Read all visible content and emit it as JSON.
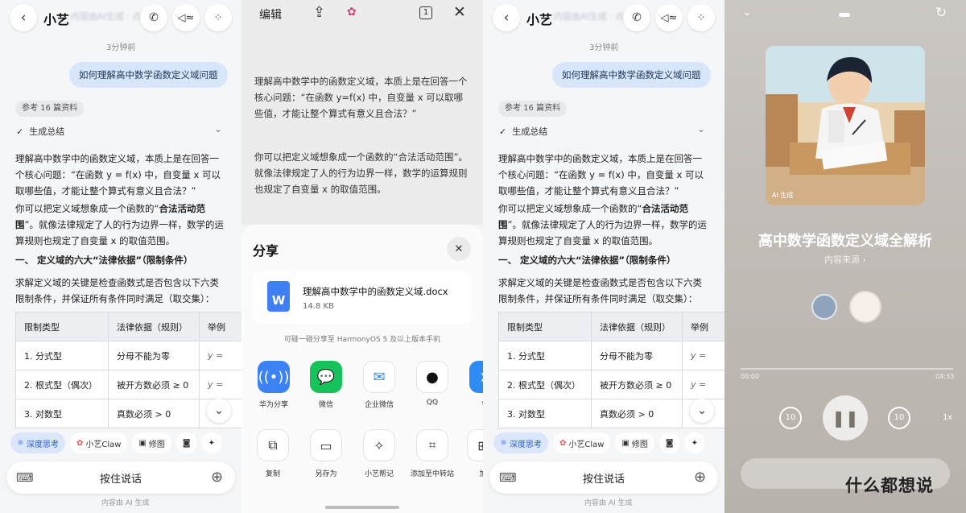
{
  "chat": {
    "title": "小艺",
    "subtitle_blur": "内容由AI生成 · 点击查看",
    "timestamp": "3分钟前",
    "user_msg": "如何理解高中数学函数定义域问题",
    "ref_label": "参考 16 篇资料",
    "summary_label": "生成总结",
    "para1": "理解高中数学中的函数定义域，本质上是在回答一个核心问题：“在函数 y = f(x) 中，自变量 x 可以取哪些值，才能让整个算式有意义且合法？”",
    "para2_a": "你可以把定义域想象成一个函数的“",
    "para2_bold": "合法活动范围",
    "para2_b": "”。就像法律规定了人的行为边界一样，数学的运算规则也规定了自变量 x 的取值范围。",
    "heading": "一、 定义域的六大“法律依据”（限制条件）",
    "para3": "求解定义域的关键是检查函数式是否包含以下六类限制条件，并保证所有条件同时满足（取交集）：",
    "table": {
      "headers": [
        "限制类型",
        "法律依据（规则）",
        "举例"
      ],
      "rows": [
        [
          "1. 分式型",
          "分母不能为零",
          "y ="
        ],
        [
          "2. 根式型（偶次）",
          "被开方数必须 ≥ 0",
          "y ="
        ],
        [
          "3. 对数型",
          "真数必须 > 0",
          ""
        ]
      ]
    },
    "tools": [
      "深度思考",
      "小艺Claw",
      "修图"
    ],
    "voice_label": "按住说话",
    "footer": "内容由 AI 生成"
  },
  "share": {
    "edit_label": "编辑",
    "page_num": "1",
    "doc_para1": "理解高中数学中的函数定义域，本质上是在回答一个核心问题：“在函数 y=f(x) 中，自变量 x 可以取哪些值，才能让整个算式有意义且合法？”",
    "doc_para2": "你可以把定义域想象成一个函数的“合法活动范围”。就像法律规定了人的行为边界一样，数学的运算规则也规定了自变量 x 的取值范围。",
    "sheet_title": "分享",
    "file_name": "理解高中数学中的函数定义域.docx",
    "file_size": "14.8 KB",
    "hint": "可碰一碰分享至 HarmonyOS 5 及以上版本手机",
    "apps": [
      "华为分享",
      "微信",
      "企业微信",
      "QQ",
      "钉"
    ],
    "actions": [
      "复制",
      "另存为",
      "小艺帮记",
      "添加至中转站",
      "加"
    ]
  },
  "player": {
    "ai_badge": "AI 生成",
    "title": "高中数学函数定义域全解析",
    "source": "内容来源 ›",
    "time_start": "00:00",
    "time_end": "04:33",
    "rewind": "10",
    "forward": "10",
    "speed": "1x",
    "watermark": "什么都想说"
  },
  "colors": {
    "accent": "#2a5bd7",
    "bubble": "#d7e6fb"
  }
}
